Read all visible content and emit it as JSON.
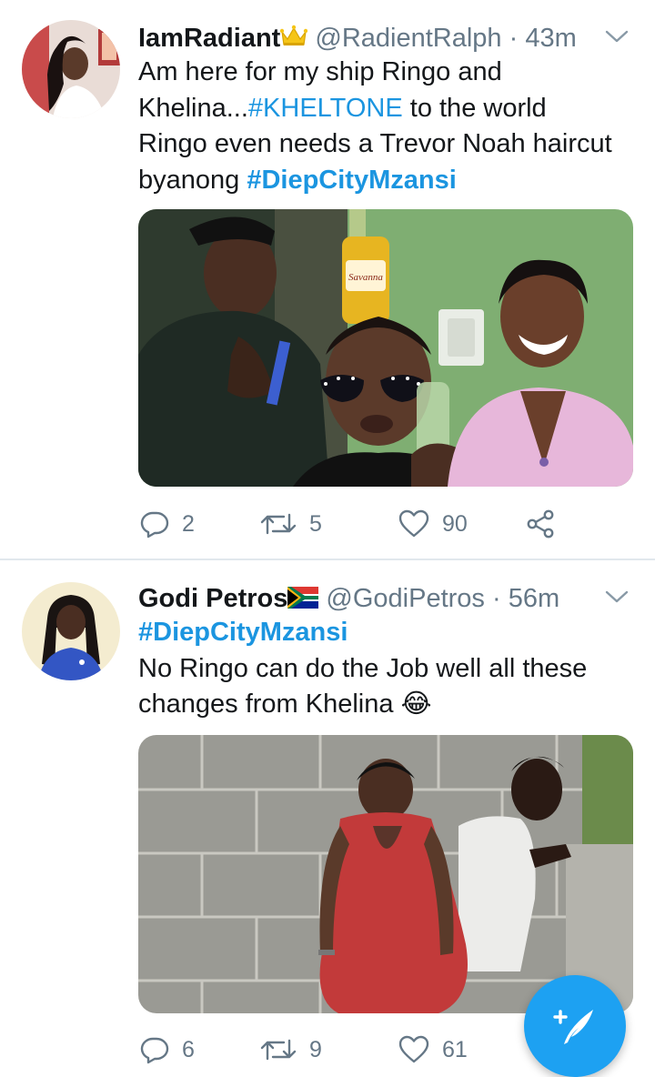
{
  "tweets": [
    {
      "name": "IamRadiant",
      "name_emoji": "crown-emoji",
      "handle": "@RadientRalph",
      "separator": "·",
      "time": "43m",
      "lines": [
        [
          {
            "t": "Am here for my ship Ringo and",
            "k": "text"
          }
        ],
        [
          {
            "t": "Khelina...",
            "k": "text"
          },
          {
            "t": "#KHELTONE",
            "k": "tag"
          },
          {
            "t": " to the world",
            "k": "text"
          }
        ],
        [
          {
            "t": "Ringo even needs a Trevor Noah haircut",
            "k": "text"
          }
        ],
        [
          {
            "t": "byanong ",
            "k": "text"
          },
          {
            "t": "#DiepCityMzansi",
            "k": "tag-bold"
          }
        ]
      ],
      "replies": "2",
      "retweets": "5",
      "likes": "90",
      "icons": [
        "reply-icon",
        "retweet-icon",
        "like-icon",
        "share-icon"
      ]
    },
    {
      "name": "Godi Petros",
      "name_emoji": "south-africa-flag-emoji",
      "handle": "@GodiPetros",
      "separator": "·",
      "time": "56m",
      "lines": [
        [
          {
            "t": "#DiepCityMzansi",
            "k": "tag-bold"
          }
        ],
        [
          {
            "t": "No Ringo can do the Job well all these",
            "k": "text"
          }
        ],
        [
          {
            "t": "changes from Khelina ",
            "k": "text"
          },
          {
            "t": "😂",
            "k": "emoji"
          }
        ]
      ],
      "replies": "6",
      "retweets": "9",
      "likes": "61",
      "icons": [
        "reply-icon",
        "retweet-icon",
        "like-icon"
      ]
    }
  ],
  "fab_icon": "compose-tweet-icon",
  "colors": {
    "accent": "#1da1f2",
    "link": "#1b95e0",
    "muted": "#657786",
    "divider": "#e1e8ed"
  }
}
